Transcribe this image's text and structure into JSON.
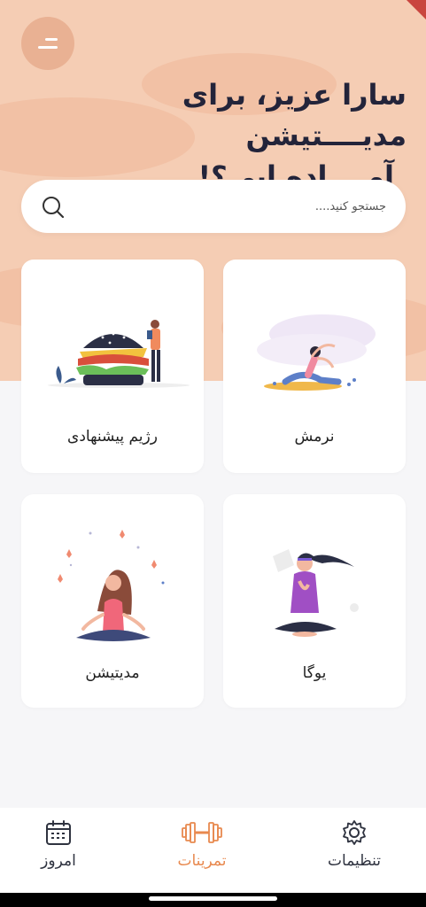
{
  "header": {
    "greeting_line1": "سارا عزیز، برای مدیــــتیشن",
    "greeting_line2": "آمــــاده ایی؟!"
  },
  "search": {
    "placeholder": "جستجو کنید...."
  },
  "categories": [
    {
      "label": "نرمش",
      "icon": "stretching-illustration"
    },
    {
      "label": "رژیم پیشنهادی",
      "icon": "burger-diet-illustration"
    },
    {
      "label": "یوگا",
      "icon": "yoga-illustration"
    },
    {
      "label": "مدیتیشن",
      "icon": "meditation-illustration"
    }
  ],
  "nav": {
    "items": [
      {
        "label": "تنظیمات",
        "icon": "gear-icon",
        "active": false
      },
      {
        "label": "تمرینات",
        "icon": "dumbbell-icon",
        "active": true
      },
      {
        "label": "امروز",
        "icon": "calendar-icon",
        "active": false
      }
    ]
  },
  "colors": {
    "hero_bg": "#f5cdb4",
    "menu_button": "#e9b193",
    "accent": "#e8894f",
    "text_dark": "#23243a",
    "nav_inactive": "#2f3340"
  }
}
